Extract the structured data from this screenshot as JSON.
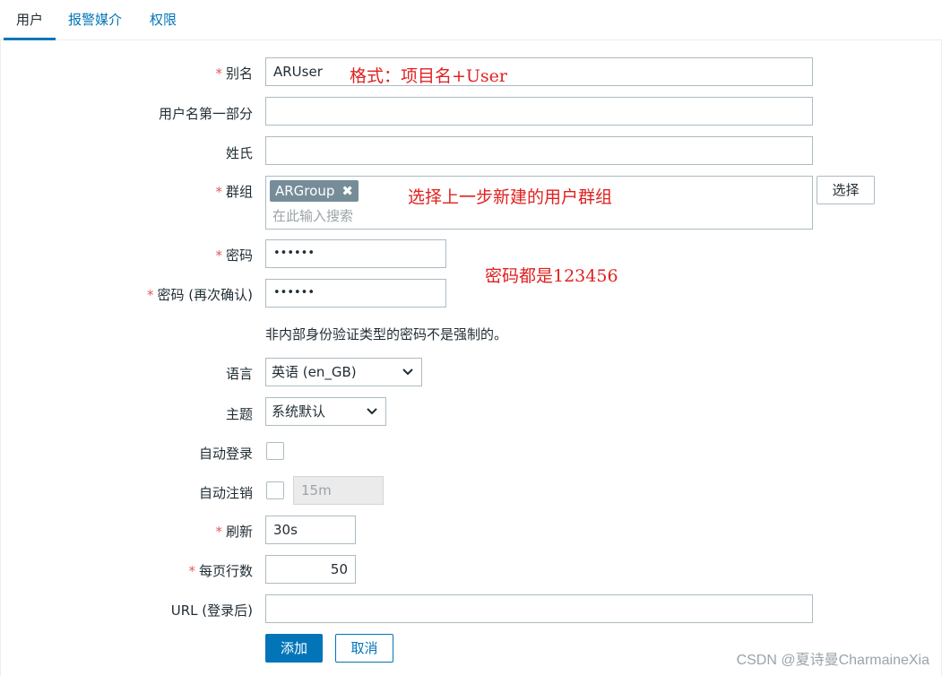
{
  "tabs": [
    {
      "label": "用户"
    },
    {
      "label": "报警媒介"
    },
    {
      "label": "权限"
    }
  ],
  "form": {
    "alias": {
      "label": "别名",
      "value": "ARUser"
    },
    "name": {
      "label": "用户名第一部分",
      "value": ""
    },
    "surname": {
      "label": "姓氏",
      "value": ""
    },
    "groups": {
      "label": "群组",
      "chip": "ARGroup",
      "chip_remove": "✖",
      "placeholder": "在此输入搜索",
      "select_button": "选择"
    },
    "password": {
      "label": "密码",
      "value": "••••••"
    },
    "password_confirm": {
      "label": "密码 (再次确认)",
      "value": "••••••"
    },
    "password_note": "非内部身份验证类型的密码不是强制的。",
    "language": {
      "label": "语言",
      "value": "英语 (en_GB)"
    },
    "theme": {
      "label": "主题",
      "value": "系统默认"
    },
    "autologin": {
      "label": "自动登录",
      "checked": false
    },
    "autologout": {
      "label": "自动注销",
      "checked": false,
      "value": "15m"
    },
    "refresh": {
      "label": "刷新",
      "value": "30s"
    },
    "rows_per_page": {
      "label": "每页行数",
      "value": "50"
    },
    "url": {
      "label": "URL (登录后)",
      "value": ""
    },
    "required_marker": "*"
  },
  "buttons": {
    "add": "添加",
    "cancel": "取消"
  },
  "annotations": {
    "alias_hint": "格式：项目名+User",
    "group_hint": "选择上一步新建的用户群组",
    "password_hint": "密码都是123456"
  },
  "watermark": "CSDN @夏诗曼CharmaineXia",
  "colors": {
    "accent": "#0275b8",
    "required": "#e45959",
    "annotation": "#e02020",
    "chip": "#768d99"
  }
}
